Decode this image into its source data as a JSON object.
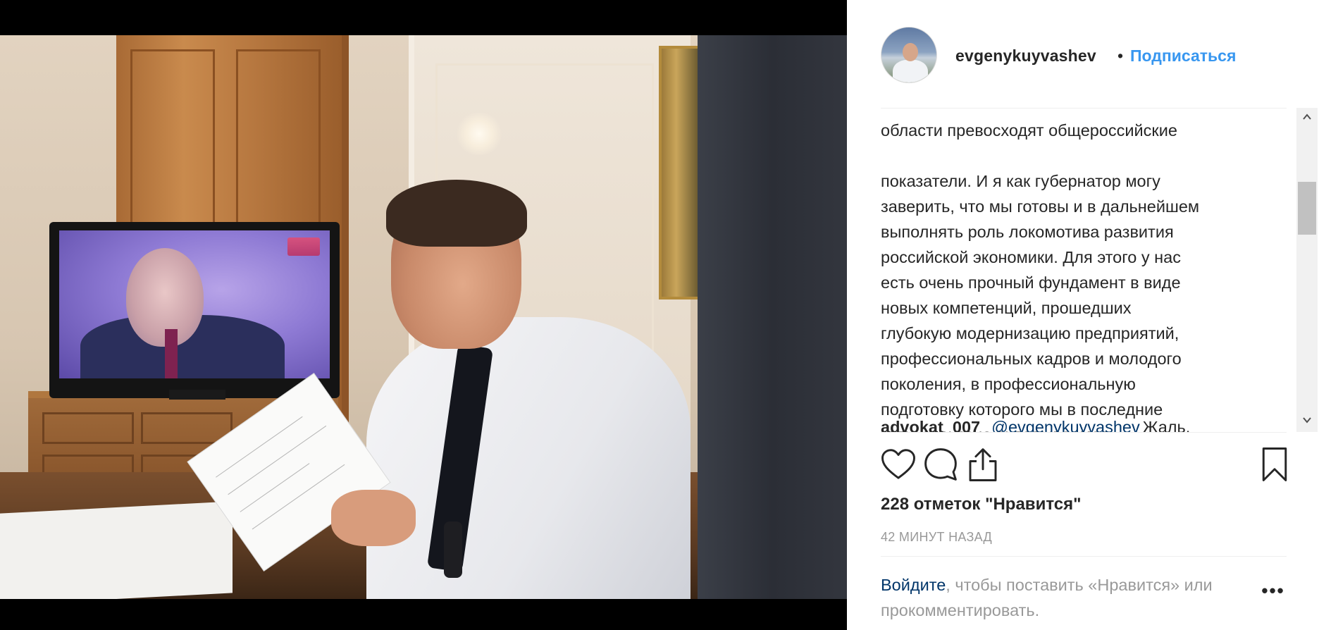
{
  "post": {
    "username": "evgenykuyvashev",
    "separator": "•",
    "follow_label": "Подписаться",
    "caption_partial_top": "области превосходят общероссийские",
    "caption": "показатели. И я как губернатор могу\nзаверить, что мы готовы и в дальнейшем\nвыполнять роль локомотива развития\nроссийской экономики. Для этого у нас\nесть очень прочный фундамент в виде\nновых компетенций, прошедших\nглубокую модернизацию предприятий,\nпрофессиональных кадров и молодого\nпоколения, в профессиональную\nподготовку которого мы в последние\nгоды серьезно вкладываемся.",
    "comment": {
      "user": "advokat_007",
      "mention": "@evgenykuyvashev",
      "text": "Жаль,"
    },
    "likes_text": "228 отметок \"Нравится\"",
    "time_text": "42 МИНУТ НАЗАД",
    "login_link": "Войдите",
    "login_rest": ", чтобы поставить «Нравится» или прокомментировать.",
    "more_label": "•••"
  },
  "icons": {
    "like": "heart-icon",
    "comment": "comment-bubble-icon",
    "share": "share-icon",
    "save": "bookmark-icon",
    "scroll_up": "chevron-up-icon",
    "scroll_down": "chevron-down-icon"
  },
  "colors": {
    "link": "#3897f0",
    "mention": "#003569",
    "muted": "#999999",
    "text": "#262626"
  }
}
